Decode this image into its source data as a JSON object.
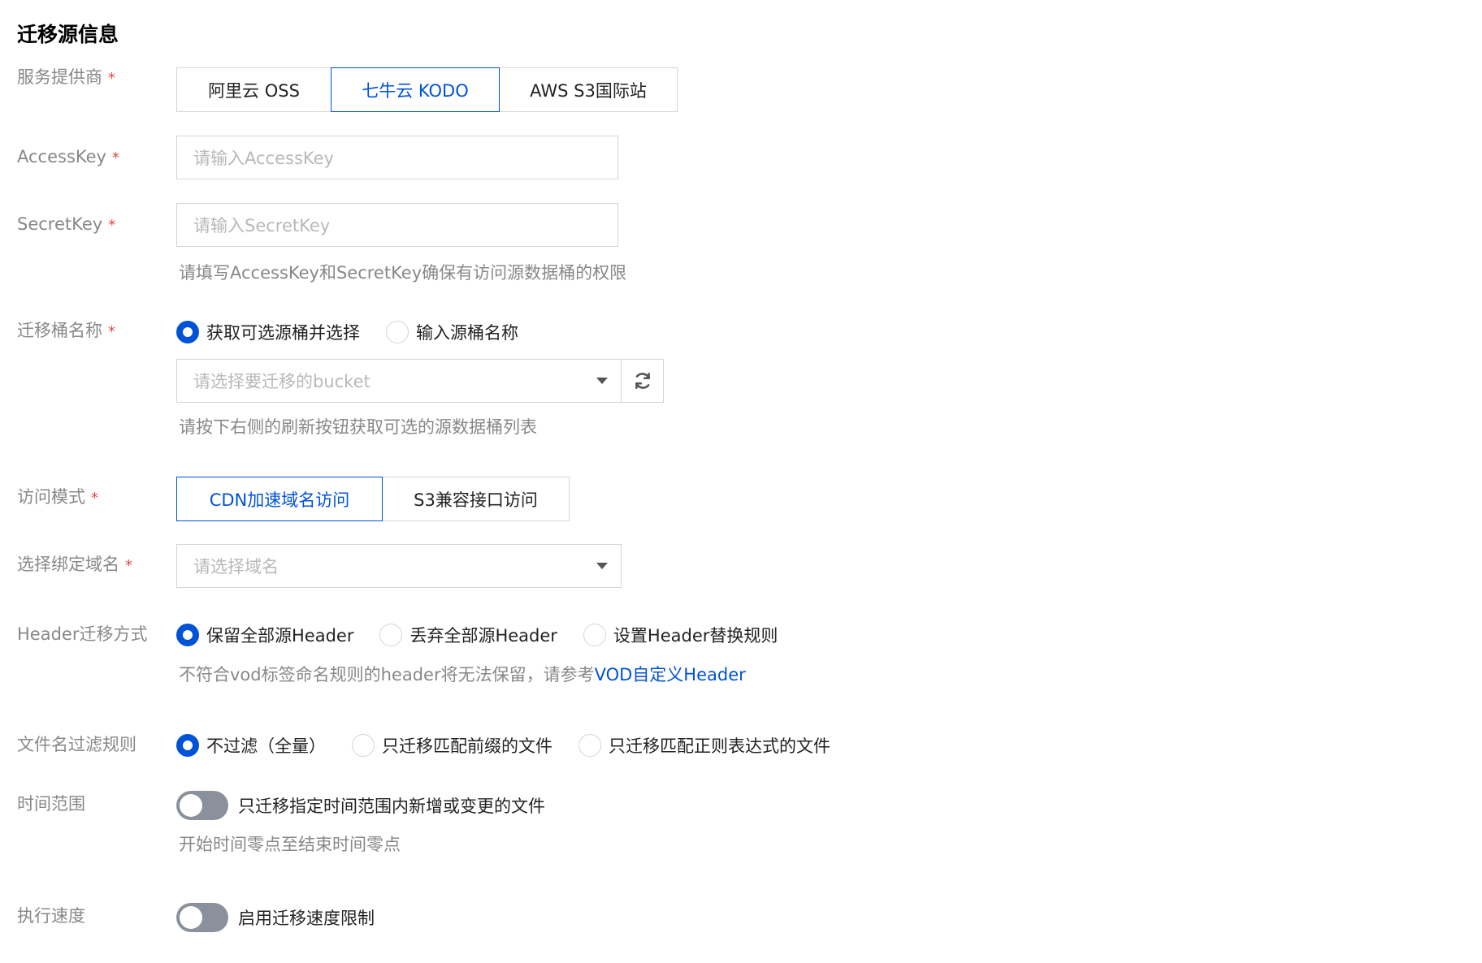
{
  "section_title": "迁移源信息",
  "provider": {
    "label": "服务提供商",
    "options": [
      "阿里云 OSS",
      "七牛云 KODO",
      "AWS S3国际站"
    ],
    "selected": "七牛云 KODO"
  },
  "access_key": {
    "label": "AccessKey",
    "placeholder": "请输入AccessKey"
  },
  "secret_key": {
    "label": "SecretKey",
    "placeholder": "请输入SecretKey"
  },
  "key_hint": "请填写AccessKey和SecretKey确保有访问源数据桶的权限",
  "bucket": {
    "label": "迁移桶名称",
    "radio_options": [
      "获取可选源桶并选择",
      "输入源桶名称"
    ],
    "selected": "获取可选源桶并选择",
    "select_placeholder": "请选择要迁移的bucket",
    "hint": "请按下右侧的刷新按钮获取可选的源数据桶列表"
  },
  "access_mode": {
    "label": "访问模式",
    "options": [
      "CDN加速域名访问",
      "S3兼容接口访问"
    ],
    "selected": "CDN加速域名访问"
  },
  "domain": {
    "label": "选择绑定域名",
    "placeholder": "请选择域名"
  },
  "header_mode": {
    "label": "Header迁移方式",
    "radio_options": [
      "保留全部源Header",
      "丢弃全部源Header",
      "设置Header替换规则"
    ],
    "selected": "保留全部源Header",
    "hint_prefix": "不符合vod标签命名规则的header将无法保留，请参考",
    "hint_link": "VOD自定义Header"
  },
  "filename_filter": {
    "label": "文件名过滤规则",
    "radio_options": [
      "不过滤（全量）",
      "只迁移匹配前缀的文件",
      "只迁移匹配正则表达式的文件"
    ],
    "selected": "不过滤（全量）"
  },
  "time_range": {
    "label": "时间范围",
    "switch_label": "只迁移指定时间范围内新增或变更的文件",
    "enabled": false,
    "hint": "开始时间零点至结束时间零点"
  },
  "speed": {
    "label": "执行速度",
    "switch_label": "启用迁移速度限制",
    "enabled": false
  },
  "required_mark": "*",
  "colors": {
    "accent": "#0052d9",
    "required": "#e54545",
    "label": "#888888",
    "switch_off": "#8b919c"
  }
}
